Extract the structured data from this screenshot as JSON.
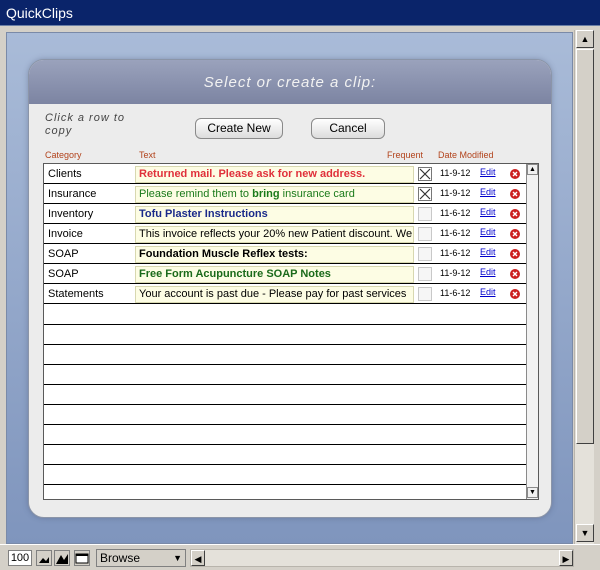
{
  "window": {
    "title": "QuickClips"
  },
  "panel": {
    "header": "Select or create a clip:",
    "hint": "Click a row to copy",
    "create_label": "Create New",
    "cancel_label": "Cancel"
  },
  "columns": {
    "category": "Category",
    "text": "Text",
    "frequent": "Frequent",
    "date": "Date Modified"
  },
  "rows": [
    {
      "category": "Clients",
      "text_html": "Returned mail.  Please ask for new address.",
      "frequent": true,
      "date": "11-9-12",
      "edit": "Edit",
      "color": "#e0303a",
      "bold": true
    },
    {
      "category": "Insurance",
      "text_html": "Please remind them to <b>bring</b> insurance card",
      "frequent": true,
      "date": "11-9-12",
      "edit": "Edit",
      "color": "#1a7a1a",
      "bold": false
    },
    {
      "category": "Inventory",
      "text_html": "Tofu Plaster Instructions",
      "frequent": false,
      "date": "11-6-12",
      "edit": "Edit",
      "color": "#1a2a8a",
      "bold": true
    },
    {
      "category": "Invoice",
      "text_html": "This invoice reflects your 20% new Patient discount.  We",
      "frequent": false,
      "date": "11-6-12",
      "edit": "Edit",
      "color": "#000000",
      "bold": false
    },
    {
      "category": "SOAP",
      "text_html": "Foundation Muscle Reflex tests:",
      "frequent": false,
      "date": "11-6-12",
      "edit": "Edit",
      "color": "#000000",
      "bold": true
    },
    {
      "category": "SOAP",
      "text_html": "Free Form Acupuncture SOAP Notes",
      "frequent": false,
      "date": "11-9-12",
      "edit": "Edit",
      "color": "#1a6a1a",
      "bold": true
    },
    {
      "category": "Statements",
      "text_html": "Your account is past due - Please pay for past services",
      "frequent": false,
      "date": "11-6-12",
      "edit": "Edit",
      "color": "#000000",
      "bold": false
    }
  ],
  "status": {
    "zoom": "100",
    "mode": "Browse"
  },
  "colors": {
    "accent": "#0a246a",
    "header_text": "#b2431c",
    "delete": "#cc1f1f"
  }
}
